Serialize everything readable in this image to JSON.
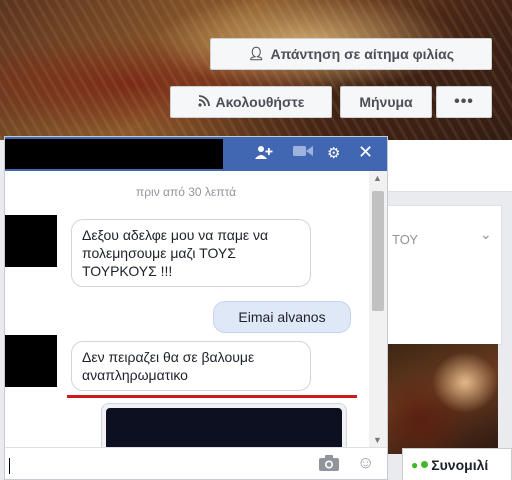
{
  "profile": {
    "friend_request_button": "Απάντηση σε αίτημα φιλίας",
    "follow_button": "Ακολουθήστε",
    "message_button": "Μήνυμα",
    "more_button": "•••"
  },
  "sidebar": {
    "partial_text": "του",
    "chevron": "⌄"
  },
  "chat": {
    "header_icons": [
      "add-friend-icon",
      "video-icon",
      "gear-icon",
      "close-icon"
    ],
    "timestamp": "πριν από 30 λεπτά",
    "messages": [
      {
        "direction": "in",
        "text_lines": [
          "Δεξου αδελφε μου να παμε να",
          "πολεμησουμε μαζι ΤΟΥΣ",
          "ΤΟΥΡΚΟΥΣ !!!"
        ]
      },
      {
        "direction": "out",
        "text_lines": [
          "Eimai alvanos"
        ]
      },
      {
        "direction": "in",
        "text_lines": [
          "Δεν πειραζει θα σε βαλουμε",
          "αναπληρωματικο"
        ]
      }
    ],
    "footer_icons": [
      "camera-icon",
      "emoji-icon"
    ]
  },
  "chat_sidebar": {
    "label": "Συνομιλί"
  },
  "colors": {
    "header_blue": "#4267b2",
    "highlight_red": "#d0191b",
    "online_green": "#42b72a"
  }
}
